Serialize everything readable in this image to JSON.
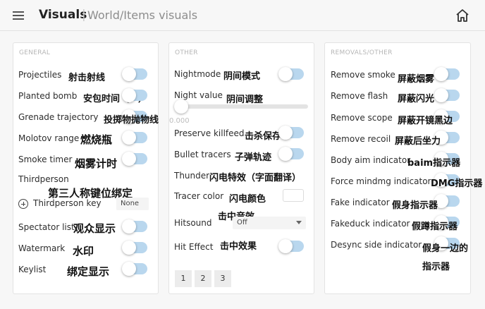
{
  "header": {
    "title": "Visuals",
    "separator": "|",
    "subtitle": "World/Items visuals"
  },
  "panels": {
    "general": {
      "header": "GENERAL",
      "projectiles": {
        "label": "Projectiles",
        "note": "射击射线",
        "enabled": false
      },
      "planted_bomb": {
        "label": "Planted bomb",
        "note": "安包时间（？）",
        "enabled": false
      },
      "grenade_trajectory": {
        "label": "Grenade trajectory",
        "note": "投掷物抛物线",
        "enabled": false
      },
      "molotov_range": {
        "label": "Molotov range",
        "note": "燃烧瓶",
        "enabled": false
      },
      "smoke_timer": {
        "label": "Smoke timer",
        "note": "烟雾计时",
        "enabled": false
      },
      "thirdperson": {
        "label": "Thirdperson",
        "note": "第三人称键位绑定"
      },
      "thirdperson_key": {
        "label": "Thirdperson key",
        "value": "None"
      },
      "spectator_list": {
        "label": "Spectator list",
        "note": "观众显示",
        "enabled": false
      },
      "watermark": {
        "label": "Watermark",
        "note": "水印",
        "enabled": false
      },
      "keylist": {
        "label": "Keylist",
        "note": "绑定显示",
        "enabled": false
      }
    },
    "other": {
      "header": "OTHER",
      "nightmode": {
        "label": "Nightmode",
        "note": "阴间模式",
        "enabled": false
      },
      "night_value": {
        "label": "Night value",
        "note": "阴间调整",
        "value": "0.000",
        "fraction": 0
      },
      "preserve_killfeed": {
        "label": "Preserve killfeed",
        "note": "击杀保存",
        "enabled": false
      },
      "bullet_tracers": {
        "label": "Bullet tracers",
        "note": "子弹轨迹",
        "enabled": false
      },
      "thunder": {
        "label": "Thunder",
        "note": "闪电特效（字面翻译）"
      },
      "tracer_color": {
        "label": "Tracer color",
        "note": "闪电颜色",
        "color": "#ffffff"
      },
      "hitsound": {
        "label": "Hitsound",
        "note": "击中音效",
        "value": "Off"
      },
      "hit_effect": {
        "label": "Hit Effect",
        "note": "击中效果",
        "enabled": false
      },
      "pages": [
        "1",
        "2",
        "3"
      ]
    },
    "removals": {
      "header": "REMOVALS/OTHER",
      "remove_smoke": {
        "label": "Remove smoke",
        "note": "屏蔽烟雾",
        "enabled": false
      },
      "remove_flash": {
        "label": "Remove flash",
        "note": "屏蔽闪光",
        "enabled": false
      },
      "remove_scope": {
        "label": "Remove scope",
        "note": "屏蔽开镜黑边",
        "enabled": false
      },
      "remove_recoil": {
        "label": "Remove recoil",
        "note": "屏蔽后坐力",
        "enabled": false
      },
      "body_aim_indicator": {
        "label": "Body aim indicator",
        "note": "baim指示器",
        "enabled": false
      },
      "force_mindmg_indicator": {
        "label": "Force mindmg indicator",
        "note": "DMG指示器",
        "enabled": false
      },
      "fake_indicator": {
        "label": "Fake indicator",
        "note": "假身指示器",
        "enabled": false
      },
      "fakeduck_indicator": {
        "label": "Fakeduck indicator",
        "note": "假蹲指示器",
        "enabled": false
      },
      "desync_side_indicator": {
        "label": "Desync side indicator",
        "note_line1": "假身一边的",
        "note_line2": "指示器",
        "enabled": false
      }
    }
  },
  "theme": {
    "toggle_track": "#b9d7ee",
    "toggle_knob": "#ffffff",
    "panel_bg": "#ffffff",
    "page_bg": "#f7f7f7"
  },
  "icons": {
    "menu": "hamburger-icon",
    "home": "home-icon",
    "add": "plus-circle-icon",
    "dropdown": "chevron-down-icon"
  }
}
